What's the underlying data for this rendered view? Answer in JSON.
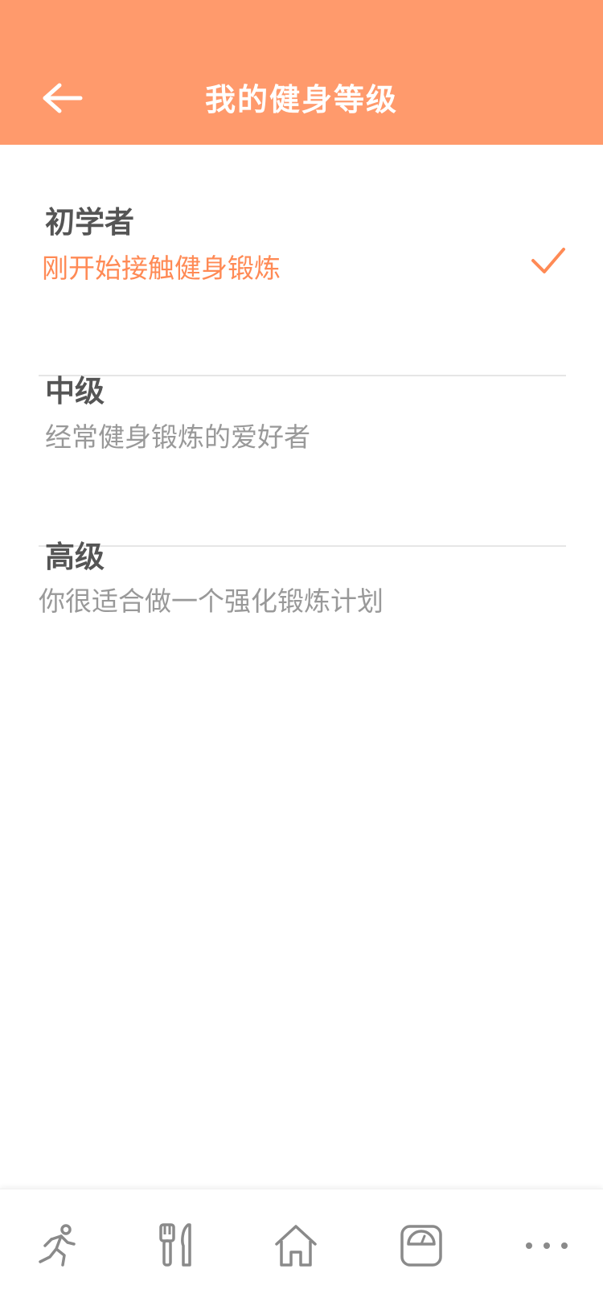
{
  "header": {
    "title": "我的健身等级",
    "background_color": "#ff9a6c",
    "back_icon": "arrow-left-icon"
  },
  "levels": [
    {
      "name": "初学者",
      "description": "刚开始接触健身锻炼",
      "selected": true
    },
    {
      "name": "中级",
      "description": "经常健身锻炼的爱好者",
      "selected": false
    },
    {
      "name": "高级",
      "description": "你很适合做一个强化锻炼计划",
      "selected": false
    }
  ],
  "colors": {
    "accent": "#ff8a55",
    "title_text": "#555555",
    "desc_text": "#999999",
    "icon_gray": "#8a8a8a"
  },
  "bottom_nav": {
    "items": [
      {
        "icon": "running-icon"
      },
      {
        "icon": "fork-knife-icon"
      },
      {
        "icon": "home-icon"
      },
      {
        "icon": "scale-icon"
      },
      {
        "icon": "more-dots-icon"
      }
    ]
  }
}
